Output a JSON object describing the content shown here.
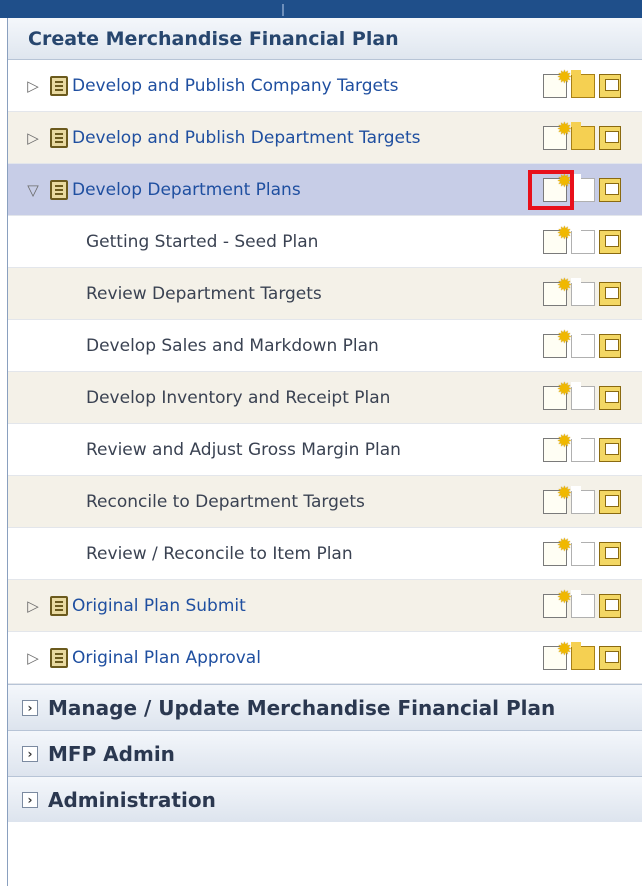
{
  "panel": {
    "title": "Create Merchandise Financial Plan"
  },
  "tasks": [
    {
      "label": "Develop and Publish Company Targets",
      "level": "parent",
      "state": "collapsed",
      "style": "odd",
      "open_active": true
    },
    {
      "label": "Develop and Publish Department Targets",
      "level": "parent",
      "state": "collapsed",
      "style": "even",
      "open_active": true
    },
    {
      "label": "Develop Department Plans",
      "level": "parent",
      "state": "expanded",
      "style": "selected",
      "open_active": false,
      "highlight_new": true
    },
    {
      "label": "Getting Started - Seed Plan",
      "level": "child",
      "style": "odd",
      "open_active": false
    },
    {
      "label": "Review Department Targets",
      "level": "child",
      "style": "even",
      "open_active": false
    },
    {
      "label": "Develop Sales and Markdown Plan",
      "level": "child",
      "style": "odd",
      "open_active": false
    },
    {
      "label": "Develop Inventory and Receipt Plan",
      "level": "child",
      "style": "even",
      "open_active": false
    },
    {
      "label": "Review and Adjust Gross Margin Plan",
      "level": "child",
      "style": "odd",
      "open_active": false
    },
    {
      "label": "Reconcile to Department Targets",
      "level": "child",
      "style": "even",
      "open_active": false
    },
    {
      "label": "Review / Reconcile to Item Plan",
      "level": "child",
      "style": "odd",
      "open_active": false
    },
    {
      "label": "Original Plan Submit",
      "level": "parent",
      "state": "collapsed",
      "style": "even",
      "open_active": false
    },
    {
      "label": "Original Plan Approval",
      "level": "parent",
      "state": "collapsed",
      "style": "odd",
      "open_active": true
    }
  ],
  "sections": [
    {
      "label": "Manage / Update Merchandise Financial Plan"
    },
    {
      "label": "MFP Admin"
    },
    {
      "label": "Administration"
    }
  ],
  "icons": {
    "collapsed": "triangle-right-icon",
    "expanded": "triangle-down-icon",
    "task_list": "workbook-icon",
    "new": "new-workbook-icon",
    "open": "open-workbook-icon",
    "save": "save-workbook-icon"
  },
  "colors": {
    "highlight": "#e8101a",
    "selected_row": "#c7cde7",
    "header_text": "#27466e"
  }
}
